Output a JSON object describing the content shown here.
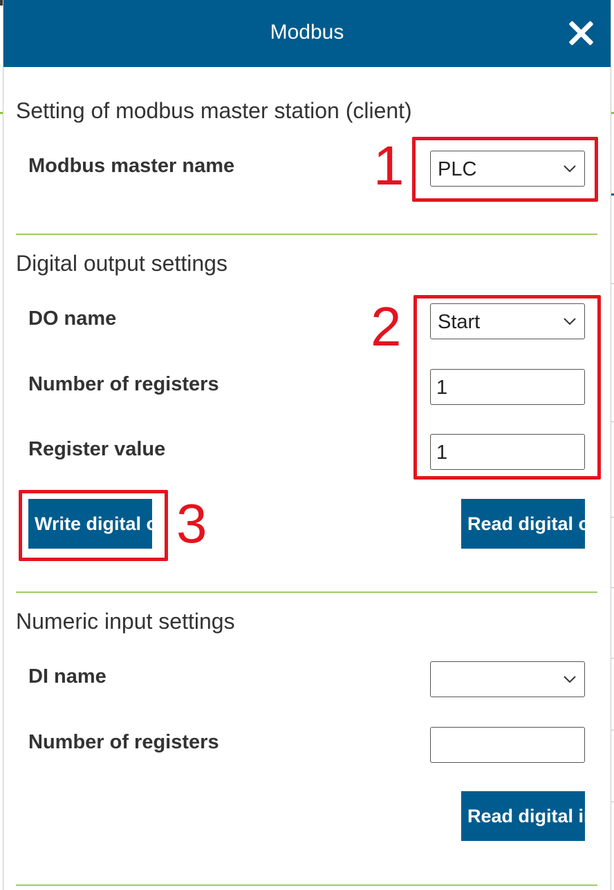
{
  "dialog": {
    "title": "Modbus",
    "close_icon": "close-icon"
  },
  "master_section": {
    "title": "Setting of modbus master station (client)",
    "master_name_label": "Modbus master name",
    "master_name_value": "PLC"
  },
  "do_section": {
    "title": "Digital output settings",
    "do_name_label": "DO name",
    "do_name_value": "Start",
    "num_registers_label": "Number of registers",
    "num_registers_value": "1",
    "register_value_label": "Register value",
    "register_value_value": "1",
    "write_button": "Write digital o",
    "read_button": "Read digital o"
  },
  "ni_section": {
    "title": "Numeric input settings",
    "di_name_label": "DI name",
    "di_name_value": "",
    "num_registers_label": "Number of registers",
    "num_registers_value": "",
    "read_button": "Read digital in"
  },
  "annotations": {
    "step1": "1",
    "step2": "2",
    "step3": "3",
    "color": "#e3141f"
  },
  "background_right_chars": [
    "t",
    "u",
    "s",
    "s",
    "s",
    "s",
    "s",
    "s"
  ],
  "colors": {
    "header": "#005c8e",
    "divider": "#9ccc65",
    "button": "#005c8e"
  }
}
